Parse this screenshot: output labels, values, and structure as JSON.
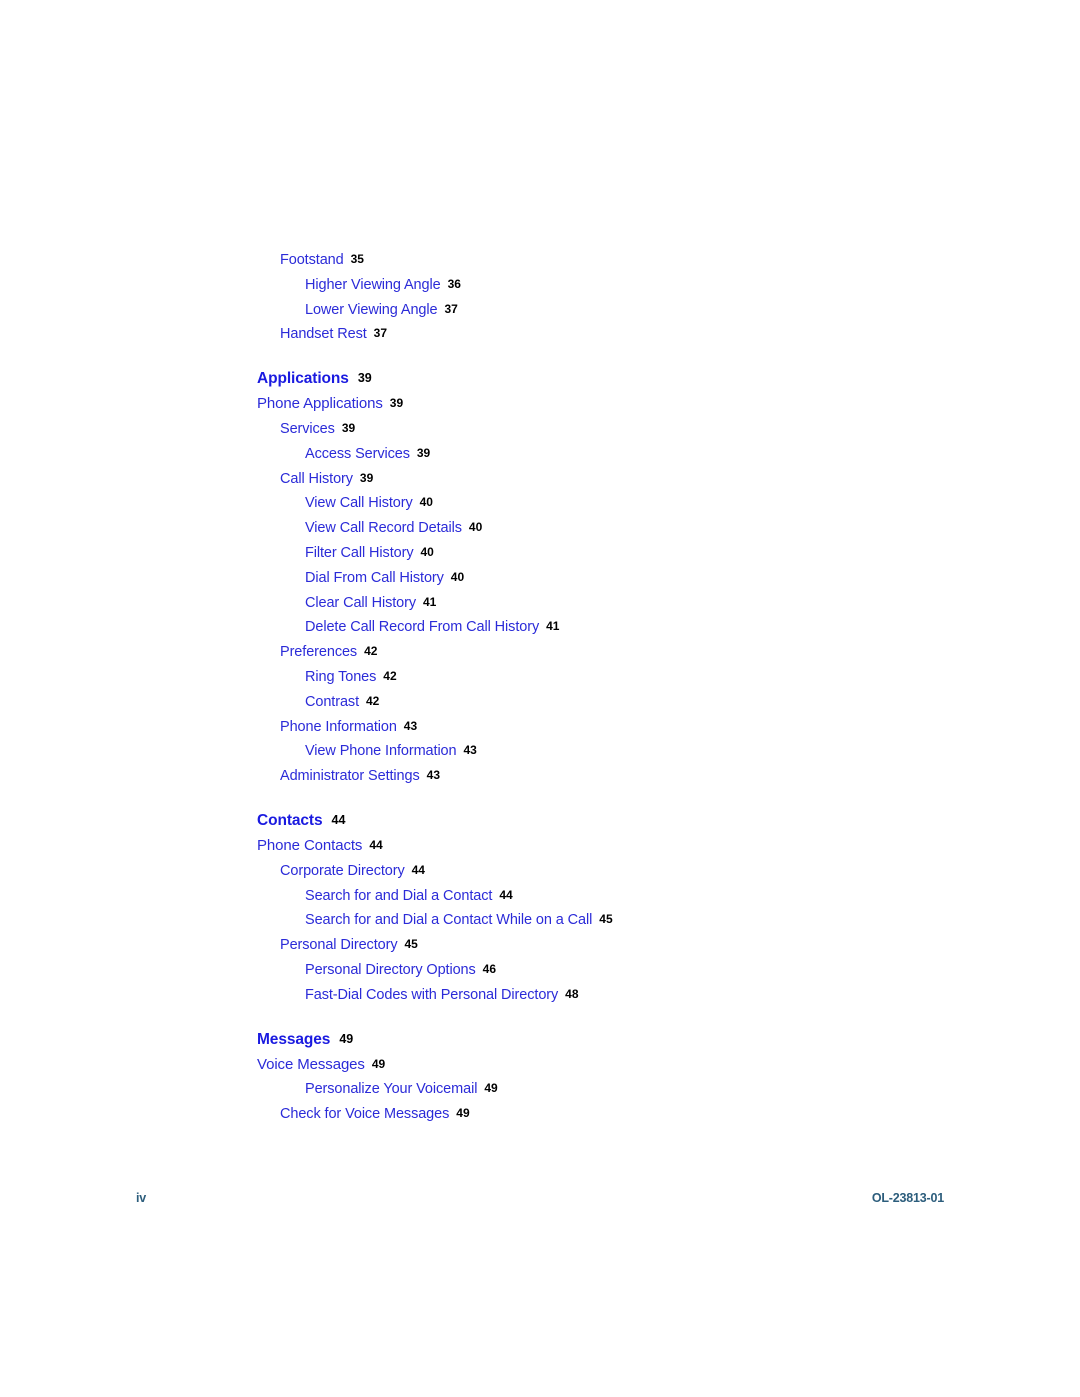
{
  "document": {
    "footer": {
      "page_number": "iv",
      "doc_id": "OL-23813-01"
    },
    "colors": {
      "entry_blue": "#2b2bd8",
      "heading_blue": "#1a1ae0",
      "page_number_black": "#000000",
      "footer_blue": "#2c5d7c"
    }
  },
  "toc": {
    "entries": [
      {
        "label": "Footstand",
        "page": "35",
        "level": 2
      },
      {
        "label": "Higher Viewing Angle",
        "page": "36",
        "level": 3
      },
      {
        "label": "Lower Viewing Angle",
        "page": "37",
        "level": 3
      },
      {
        "label": "Handset Rest",
        "page": "37",
        "level": 2
      },
      {
        "label": "Applications",
        "page": "39",
        "level": 0
      },
      {
        "label": "Phone Applications",
        "page": "39",
        "level": 1
      },
      {
        "label": "Services",
        "page": "39",
        "level": 2
      },
      {
        "label": "Access Services",
        "page": "39",
        "level": 3
      },
      {
        "label": "Call History",
        "page": "39",
        "level": 2
      },
      {
        "label": "View Call History",
        "page": "40",
        "level": 3
      },
      {
        "label": "View Call Record Details",
        "page": "40",
        "level": 3
      },
      {
        "label": "Filter Call History",
        "page": "40",
        "level": 3
      },
      {
        "label": "Dial From Call History",
        "page": "40",
        "level": 3
      },
      {
        "label": "Clear Call History",
        "page": "41",
        "level": 3
      },
      {
        "label": "Delete Call Record From Call History",
        "page": "41",
        "level": 3
      },
      {
        "label": "Preferences",
        "page": "42",
        "level": 2
      },
      {
        "label": "Ring Tones",
        "page": "42",
        "level": 3
      },
      {
        "label": "Contrast",
        "page": "42",
        "level": 3
      },
      {
        "label": "Phone Information",
        "page": "43",
        "level": 2
      },
      {
        "label": "View Phone Information",
        "page": "43",
        "level": 3
      },
      {
        "label": "Administrator Settings",
        "page": "43",
        "level": 2
      },
      {
        "label": "Contacts",
        "page": "44",
        "level": 0
      },
      {
        "label": "Phone Contacts",
        "page": "44",
        "level": 1
      },
      {
        "label": "Corporate Directory",
        "page": "44",
        "level": 2
      },
      {
        "label": "Search for and Dial a Contact",
        "page": "44",
        "level": 3
      },
      {
        "label": "Search for and Dial a Contact While on a Call",
        "page": "45",
        "level": 3
      },
      {
        "label": "Personal Directory",
        "page": "45",
        "level": 2
      },
      {
        "label": "Personal Directory Options",
        "page": "46",
        "level": 3
      },
      {
        "label": "Fast-Dial Codes with Personal Directory",
        "page": "48",
        "level": 3
      },
      {
        "label": "Messages",
        "page": "49",
        "level": 0
      },
      {
        "label": "Voice Messages",
        "page": "49",
        "level": 1
      },
      {
        "label": "Personalize Your Voicemail",
        "page": "49",
        "level": 3
      },
      {
        "label": "Check for Voice Messages",
        "page": "49",
        "level": 2
      }
    ]
  }
}
